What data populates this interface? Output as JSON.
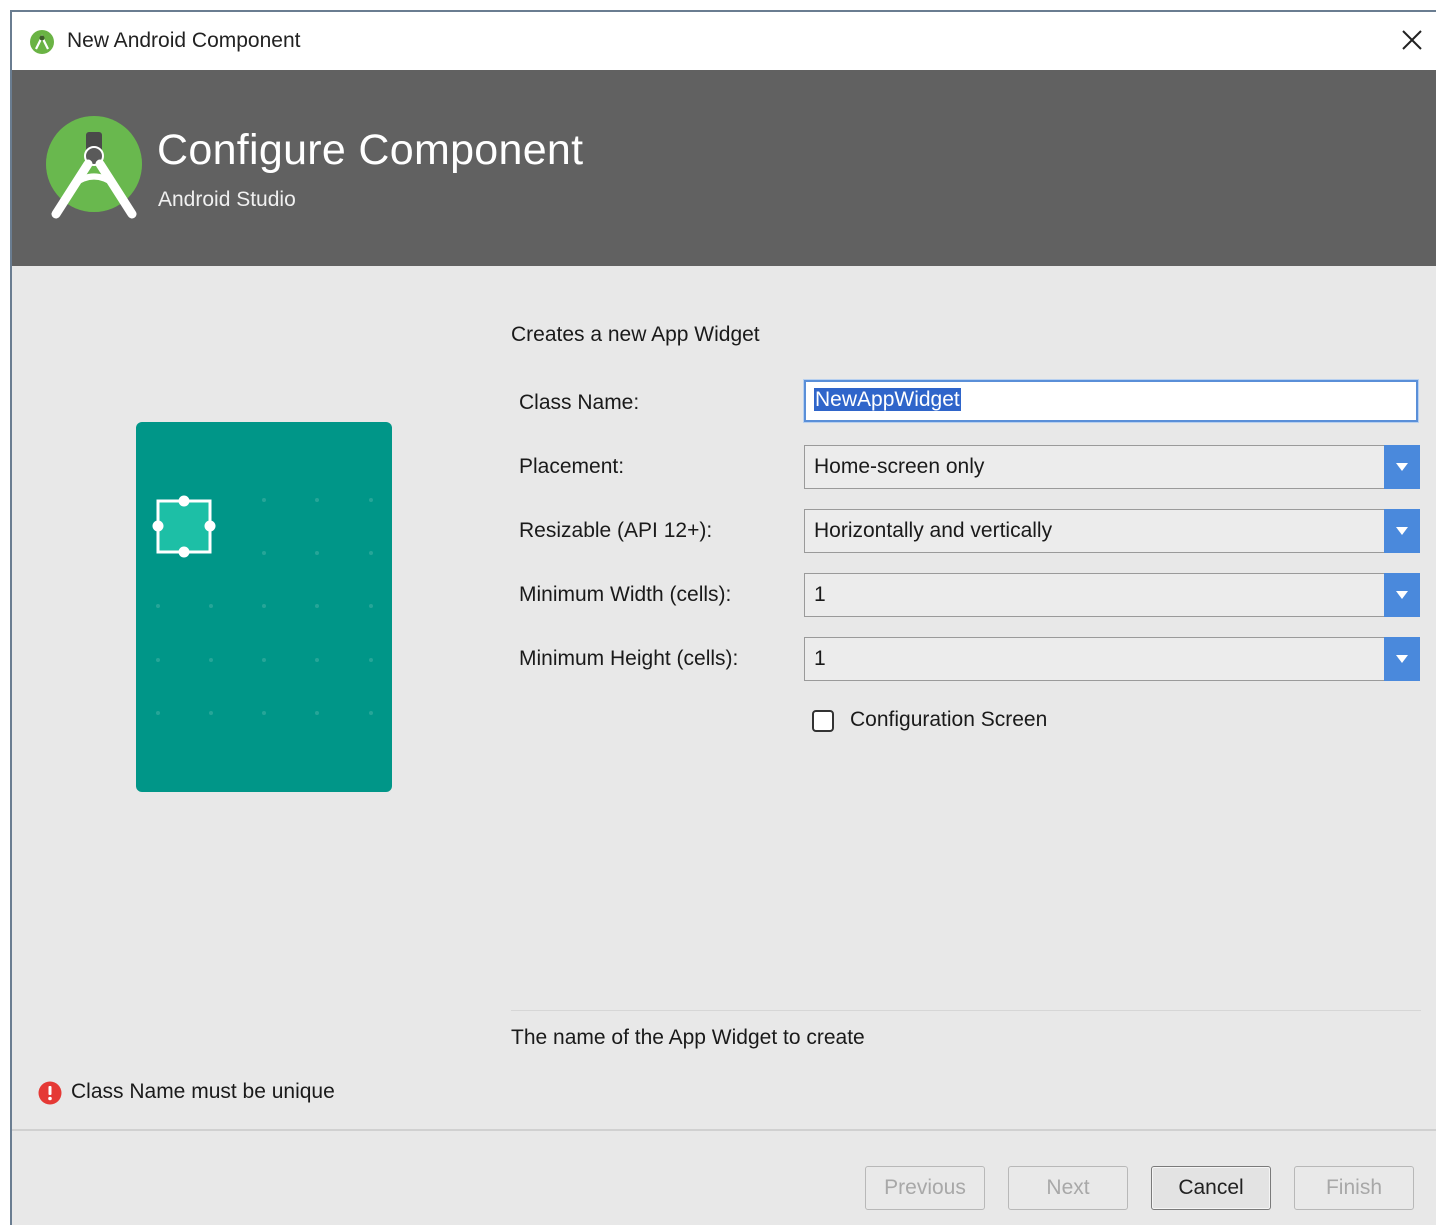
{
  "window": {
    "title": "New Android Component"
  },
  "header": {
    "title": "Configure Component",
    "subtitle": "Android Studio"
  },
  "form": {
    "description": "Creates a new App Widget",
    "class_name": {
      "label": "Class Name:",
      "value": "NewAppWidget"
    },
    "placement": {
      "label": "Placement:",
      "value": "Home-screen only"
    },
    "resizable": {
      "label": "Resizable (API 12+):",
      "value": "Horizontally and vertically"
    },
    "min_width": {
      "label": "Minimum Width (cells):",
      "value": "1"
    },
    "min_height": {
      "label": "Minimum Height (cells):",
      "value": "1"
    },
    "config_screen": {
      "label": "Configuration Screen",
      "checked": false
    },
    "help_text": "The name of the App Widget to create"
  },
  "validation": {
    "error_message": "Class Name must be unique"
  },
  "buttons": {
    "previous": "Previous",
    "next": "Next",
    "cancel": "Cancel",
    "finish": "Finish"
  },
  "colors": {
    "banner": "#616161",
    "preview": "#009688",
    "accent": "#4a89dc",
    "selection": "#2f65ca",
    "error": "#e53935"
  }
}
